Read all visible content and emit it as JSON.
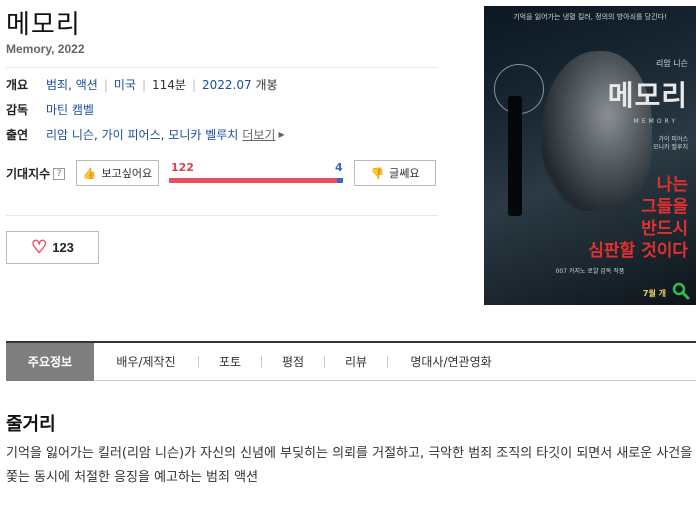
{
  "movie": {
    "title": "메모리",
    "subtitle": "Memory, 2022"
  },
  "info": {
    "overview_label": "개요",
    "genres": [
      "범죄",
      "액션"
    ],
    "country": "미국",
    "runtime": "114분",
    "release_date": "2022.07",
    "release_suffix": "개봉",
    "director_label": "감독",
    "director": "마틴 캠벨",
    "cast_label": "출연",
    "cast": [
      "리암 니슨",
      "가이 피어스",
      "모니카 벨루치"
    ],
    "more_label": "더보기"
  },
  "expectation": {
    "label": "기대지수",
    "help_icon_text": "?",
    "want_label": "보고싶어요",
    "want_count": "122",
    "nah_label": "글쎄요",
    "nah_count": "4",
    "want_ratio": 0.968
  },
  "like": {
    "count": "123"
  },
  "poster": {
    "top_text": "기억을 잃어가는 냉혈 킬러, 정의의 방아쇠를 당긴다!",
    "cast_name": "리암 니슨",
    "title": "메모리",
    "title_en": "MEMORY",
    "credits": "가이 피어스\n모니카 벨루치",
    "tagline": [
      "나는",
      "그들을",
      "반드시",
      "심판할 것이다"
    ],
    "bottom_text": "007 카지노 로얄 감독 작품",
    "date": "7월 개"
  },
  "tabs": [
    "주요정보",
    "배우/제작진",
    "포토",
    "평점",
    "리뷰",
    "명대사/연관영화"
  ],
  "synopsis": {
    "title": "줄거리",
    "text": "기억을 잃어가는 킬러(리암 니슨)가 자신의 신념에 부딪히는 의뢰를 거절하고, 극악한 범죄 조직의 타깃이 되면서 새로운 사건을 쫓는 동시에 처절한 응징을 예고하는 범죄 액션"
  },
  "colors": {
    "want": "#e85260",
    "nah": "#3a68c8",
    "link": "#1a4fa0",
    "active_tab": "#7f7f7f"
  }
}
